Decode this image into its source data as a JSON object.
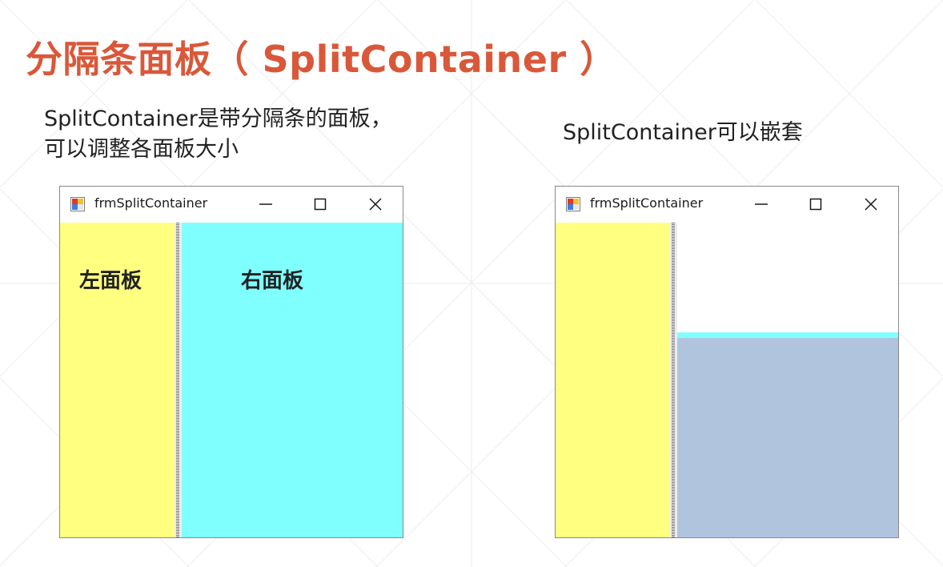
{
  "slide": {
    "title": "分隔条面板（ SplitContainer ）",
    "caption_left": [
      "SplitContainer是带分隔条的面板，",
      "可以调整各面板大小"
    ],
    "caption_right": "SplitContainer可以嵌套"
  },
  "windows": [
    {
      "title": "frmSplitContainer",
      "controls": [
        "minimize-icon",
        "maximize-icon",
        "close-icon"
      ],
      "left_panel": {
        "label": "左面板",
        "color": "#ffff80"
      },
      "right_panel": {
        "label": "右面板",
        "color": "#80ffff"
      }
    },
    {
      "title": "frmSplitContainer",
      "controls": [
        "minimize-icon",
        "maximize-icon",
        "close-icon"
      ],
      "left_panel": {
        "color": "#ffff80"
      },
      "nested": {
        "top_panel_color": "#ffffff",
        "splitter_color": "#80ffff",
        "bottom_panel_color": "#b0c4de"
      }
    }
  ],
  "colors": {
    "title_accent": "#d9583a",
    "background_grid": "#eeeeee"
  }
}
